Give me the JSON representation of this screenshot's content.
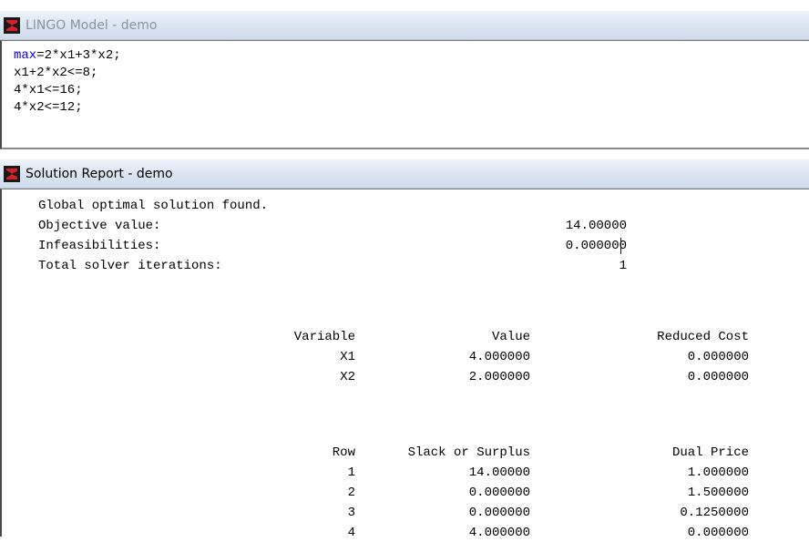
{
  "model_window": {
    "title": "LINGO Model - demo",
    "code": {
      "line1_keyword": "max",
      "line1_rest": "=2*x1+3*x2;",
      "line2": "x1+2*x2<=8;",
      "line3": "4*x1<=16;",
      "line4": "4*x2<=12;"
    }
  },
  "report_window": {
    "title": "Solution Report - demo",
    "status": "Global optimal solution found.",
    "objective_label": "Objective value:",
    "objective_value": "14.00000",
    "infeasibilities_label": "Infeasibilities:",
    "infeasibilities_value": "0.000000",
    "iterations_label": "Total solver iterations:",
    "iterations_value": "1",
    "variables_table": {
      "headers": [
        "Variable",
        "Value",
        "Reduced Cost"
      ],
      "rows": [
        [
          "X1",
          "4.000000",
          "0.000000"
        ],
        [
          "X2",
          "2.000000",
          "0.000000"
        ]
      ]
    },
    "rows_table": {
      "headers": [
        "Row",
        "Slack or Surplus",
        "Dual Price"
      ],
      "rows": [
        [
          "1",
          "14.00000",
          "1.000000"
        ],
        [
          "2",
          "0.000000",
          "1.500000"
        ],
        [
          "3",
          "0.000000",
          "0.1250000"
        ],
        [
          "4",
          "4.000000",
          "0.000000"
        ]
      ]
    }
  },
  "colors": {
    "keyword": "#0000ee",
    "inactive_title": "#8a929c",
    "active_title": "#000000",
    "icon_red": "#d8202a"
  },
  "icons": {
    "app": "lingo-logo-icon"
  }
}
